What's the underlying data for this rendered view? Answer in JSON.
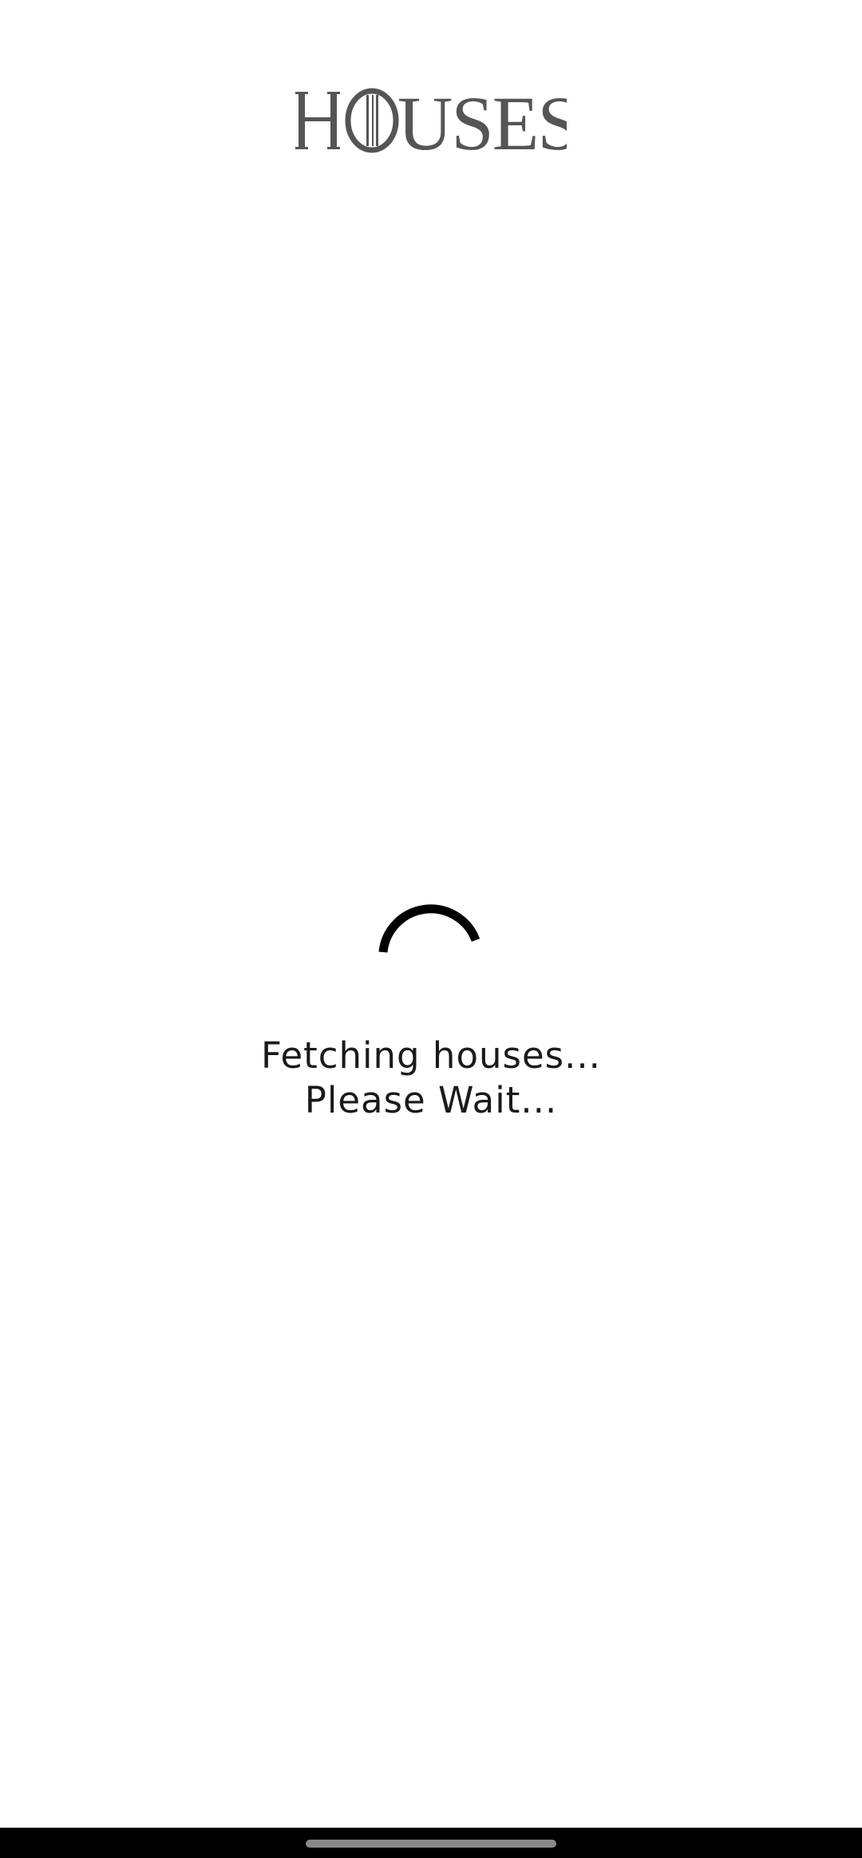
{
  "header": {
    "logo_text": "HOUSES"
  },
  "loading": {
    "line1": "Fetching houses...",
    "line2": "Please Wait..."
  },
  "colors": {
    "background": "#ffffff",
    "logo": "#555555",
    "spinner": "#000000",
    "text": "#1a1a1a",
    "nav_bar": "#000000",
    "home_indicator": "#8a8a8a"
  }
}
